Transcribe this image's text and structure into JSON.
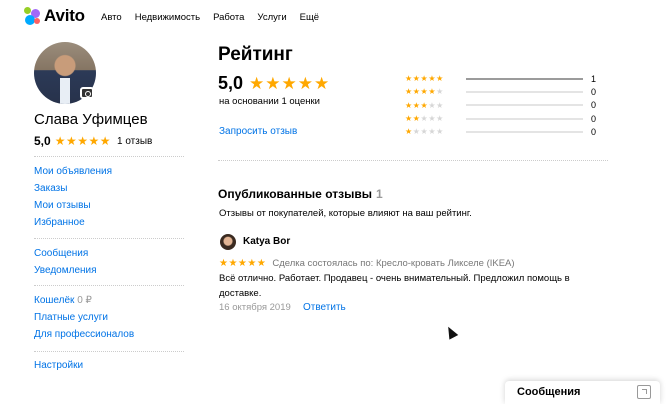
{
  "header": {
    "logo": "Avito",
    "nav": [
      "Авто",
      "Недвижимость",
      "Работа",
      "Услуги",
      "Ещё"
    ]
  },
  "profile": {
    "name": "Слава Уфимцев",
    "rating": "5,0",
    "stars": "★★★★★",
    "reviews_count": "1 отзыв"
  },
  "sidebar": {
    "group1": [
      "Мои объявления",
      "Заказы",
      "Мои отзывы",
      "Избранное"
    ],
    "group2": [
      "Сообщения",
      "Уведомления"
    ],
    "group3": {
      "wallet": "Кошелёк",
      "wallet_balance": "0 ₽",
      "paid": "Платные услуги",
      "pro": "Для профессионалов"
    },
    "group4": [
      "Настройки"
    ]
  },
  "rating_page": {
    "title": "Рейтинг",
    "rating": "5,0",
    "stars": "★★★★★",
    "based_on": "на основании 1 оценки",
    "request": "Запросить отзыв",
    "breakdown": [
      {
        "stars": 5,
        "count": "1",
        "fraction": 1
      },
      {
        "stars": 4,
        "count": "0",
        "fraction": 0
      },
      {
        "stars": 3,
        "count": "0",
        "fraction": 0
      },
      {
        "stars": 2,
        "count": "0",
        "fraction": 0
      },
      {
        "stars": 1,
        "count": "0",
        "fraction": 0
      }
    ]
  },
  "reviews": {
    "title": "Опубликованные отзывы",
    "count": "1",
    "subtitle": "Отзывы от покупателей, которые влияют на ваш рейтинг.",
    "items": [
      {
        "author": "Katya Bor",
        "stars": "★★★★★",
        "deal": "Сделка состоялась по: Кресло-кровать Ликселе (IKEA)",
        "text": "Всё отлично. Работает. Продавец - очень внимательный. Предложил помощь в доставке.",
        "date": "16 октября 2019",
        "reply": "Ответить"
      }
    ]
  },
  "messenger": {
    "label": "Сообщения"
  },
  "colors": {
    "accent_link": "#0073e6",
    "star": "#ffa800",
    "star_off": "#d6d6d6"
  }
}
